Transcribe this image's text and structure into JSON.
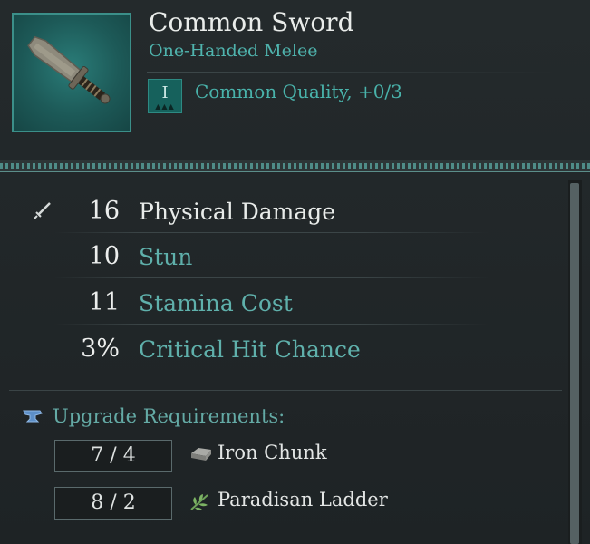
{
  "item": {
    "name": "Common Sword",
    "type": "One-Handed Melee",
    "quality_level": "I",
    "quality_text": "Common Quality, +0/3",
    "icon": "sword-item-icon"
  },
  "stats": [
    {
      "value": "16",
      "label": "Physical Damage",
      "style": "primary",
      "icon": "sword-stat-icon"
    },
    {
      "value": "10",
      "label": "Stun",
      "style": "secondary"
    },
    {
      "value": "11",
      "label": "Stamina Cost",
      "style": "secondary"
    },
    {
      "value": "3%",
      "label": "Critical Hit Chance",
      "style": "secondary"
    }
  ],
  "upgrade": {
    "heading": "Upgrade Requirements:",
    "icon": "anvil-icon",
    "requirements": [
      {
        "count": "7 / 4",
        "name": "Iron Chunk",
        "icon": "iron-ingot-icon"
      },
      {
        "count": "8 / 2",
        "name": "Paradisan Ladder",
        "icon": "herb-icon"
      }
    ]
  },
  "colors": {
    "accent_teal": "#4fb3ad",
    "panel_bg": "#1f2426",
    "text_light": "#e9ecea"
  }
}
